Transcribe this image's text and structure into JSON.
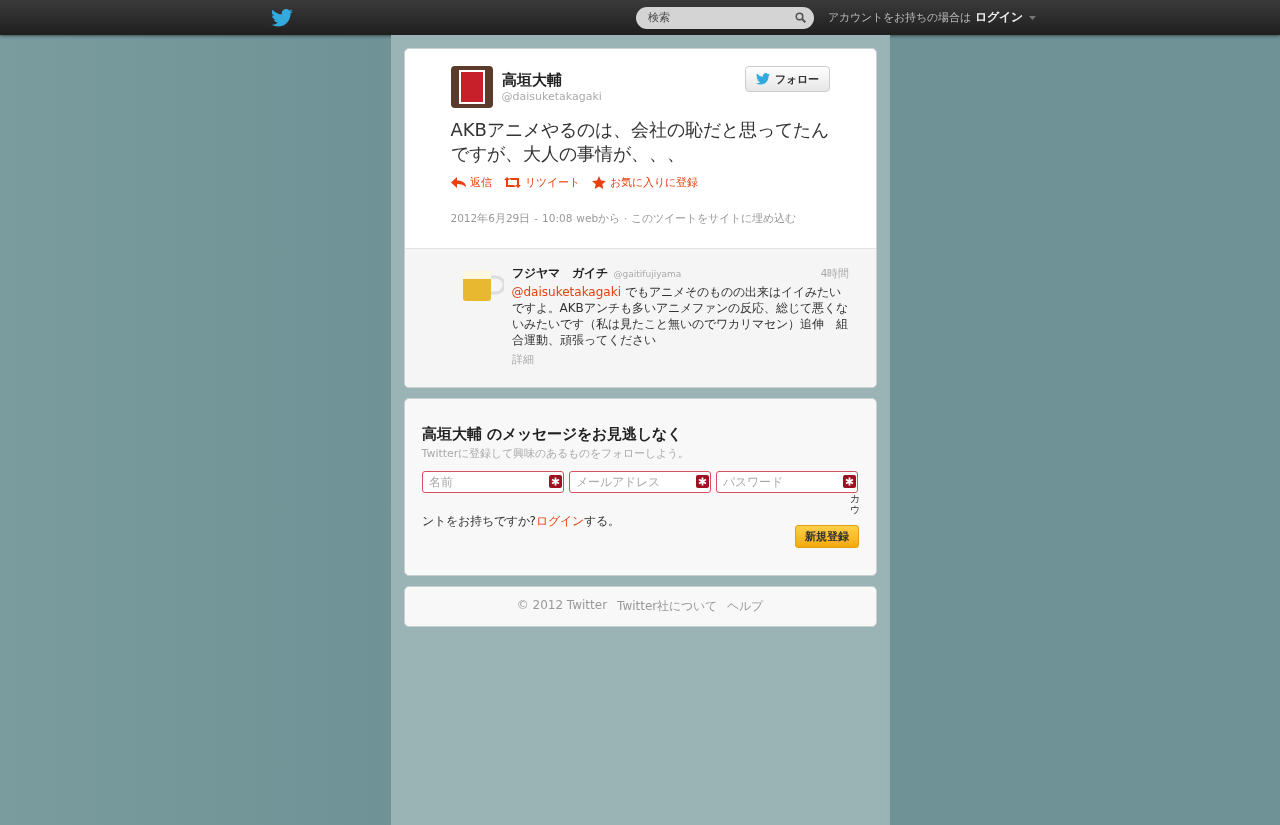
{
  "topbar": {
    "search": {
      "placeholder": "検索"
    },
    "account_prompt": "アカウントをお持ちの場合は",
    "login": "ログイン"
  },
  "tweet": {
    "author": {
      "name": "高垣大輔",
      "handle": "@daisuketakagaki"
    },
    "follow_button": "フォロー",
    "text": "AKBアニメやるのは、会社の恥だと思ってたんですが、大人の事情が、、、",
    "actions": [
      {
        "kind": "reply",
        "label": "返信"
      },
      {
        "kind": "retweet",
        "label": "リツイート"
      },
      {
        "kind": "favorite",
        "label": "お気に入りに登録"
      }
    ],
    "meta": {
      "date": "2012年6月29日",
      "separator": "-",
      "time": "10:08",
      "via": "webから",
      "dot": "·",
      "embed": "このツイートをサイトに埋め込む"
    }
  },
  "replies": [
    {
      "name": "フジヤマ　ガイチ",
      "handle": "@gaitifujiyama",
      "time": "4時間",
      "mention": "@daisuketakagaki",
      "text": "でもアニメそのものの出来はイイみたいですよ。AKBアンチも多いアニメファンの反応、総じて悪くないみたいです（私は見たこと無いのでワカリマセン）追伸　組合運動、頑張ってください",
      "details": "詳細"
    }
  ],
  "signup": {
    "title": "高垣大輔 のメッセージをお見逃しなく",
    "subtitle": "Twitterに登録して興味のあるものをフォローしよう。",
    "fields": [
      {
        "placeholder": "名前",
        "required": true
      },
      {
        "placeholder": "メールアドレス",
        "required": true
      },
      {
        "placeholder": "パスワード",
        "required": true
      }
    ],
    "overflow_text": "カウ",
    "login_prompt": {
      "before": "ントをお持ちですか?",
      "link": "ログイン",
      "after": "する。"
    },
    "submit": "新規登録"
  },
  "footer": {
    "links": [
      "© 2012 Twitter",
      "Twitter社について",
      "ヘルプ"
    ]
  }
}
